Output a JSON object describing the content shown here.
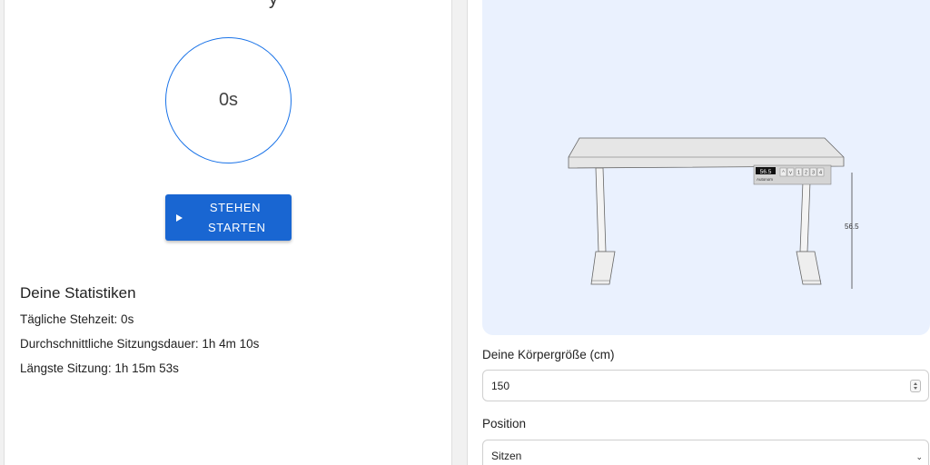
{
  "left": {
    "title_fragment": "y",
    "timer": "0s",
    "start_button": {
      "line1": "STEHEN",
      "line2": "STARTEN"
    },
    "stats": {
      "heading": "Deine Statistiken",
      "daily": "Tägliche Stehzeit: 0s",
      "average": "Durchschnittliche Sitzungsdauer: 1h 4m 10s",
      "longest": "Längste Sitzung: 1h 15m 53s"
    }
  },
  "desk": {
    "display_value": "56.5",
    "brand": "Autonom",
    "keys": [
      "^",
      "v",
      "1",
      "2",
      "3",
      "4"
    ],
    "height_label": "56.5"
  },
  "form": {
    "height_label": "Deine Körpergröße (cm)",
    "height_value": "150",
    "position_label": "Position",
    "position_value": "Sitzen"
  },
  "colors": {
    "accent": "#1966d2",
    "panel": "#eaf1fe"
  }
}
